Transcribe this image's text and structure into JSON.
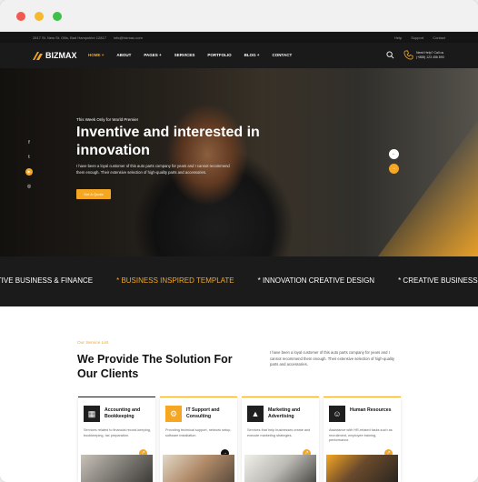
{
  "topbar": {
    "address": "2817 St. New St. Ollis, Bad Hampshire 12817",
    "email": "info@bizmax.com",
    "links": [
      "Help",
      "Support",
      "Contact"
    ]
  },
  "brand": {
    "name": "BIZMAX"
  },
  "menu": {
    "items": [
      {
        "label": "HOME +"
      },
      {
        "label": "ABOUT"
      },
      {
        "label": "PAGES +"
      },
      {
        "label": "SERVICES"
      },
      {
        "label": "PORTFOLIO"
      },
      {
        "label": "BLOG +"
      },
      {
        "label": "CONTACT"
      }
    ]
  },
  "header": {
    "phone_label": "Need Help? Call us",
    "phone_number": "(+888) 123 456 890"
  },
  "hero": {
    "tagline": "This Week Only for World Premier",
    "title": "Inventive and interested in innovation",
    "description": "I have been a loyal customer of this auto parts company for years and I cannot recommend them enough. Their extensive selection of high-quality parts and accessories.",
    "button": "Get A Quote",
    "social": [
      "f",
      "t",
      "▶",
      "◎"
    ]
  },
  "ticker": {
    "items": [
      {
        "text": "ATIVE BUSINESS & FINANCE",
        "highlight": false
      },
      {
        "text": "* BUSINESS INSPIRED TEMPLATE",
        "highlight": true
      },
      {
        "text": "* INNOVATION CREATIVE DESIGN",
        "highlight": false
      },
      {
        "text": "* CREATIVE BUSINESS",
        "highlight": false
      }
    ]
  },
  "services": {
    "eyebrow": "Our Service List",
    "title": "We Provide The Solution For Our Clients",
    "intro": "I have been a loyal customer of this auto parts company for years and I cannot recommend them enough. Their extensive selection of high-quality parts and accessories.",
    "cards": [
      {
        "title": "Accounting and Bookkeeping",
        "text": "Services related to financial record-keeping, bookkeeping, tax preparation."
      },
      {
        "title": "IT Support and Consulting",
        "text": "Providing technical support, network setup, software installation."
      },
      {
        "title": "Marketing and Advertising",
        "text": "Services that help businesses create and execute marketing strategies."
      },
      {
        "title": "Human Resources",
        "text": "Assistance with HR-related tasks such as recruitment, employee training, performance."
      }
    ]
  },
  "colors": {
    "accent": "#f5a623",
    "dark": "#1a1a1a"
  }
}
